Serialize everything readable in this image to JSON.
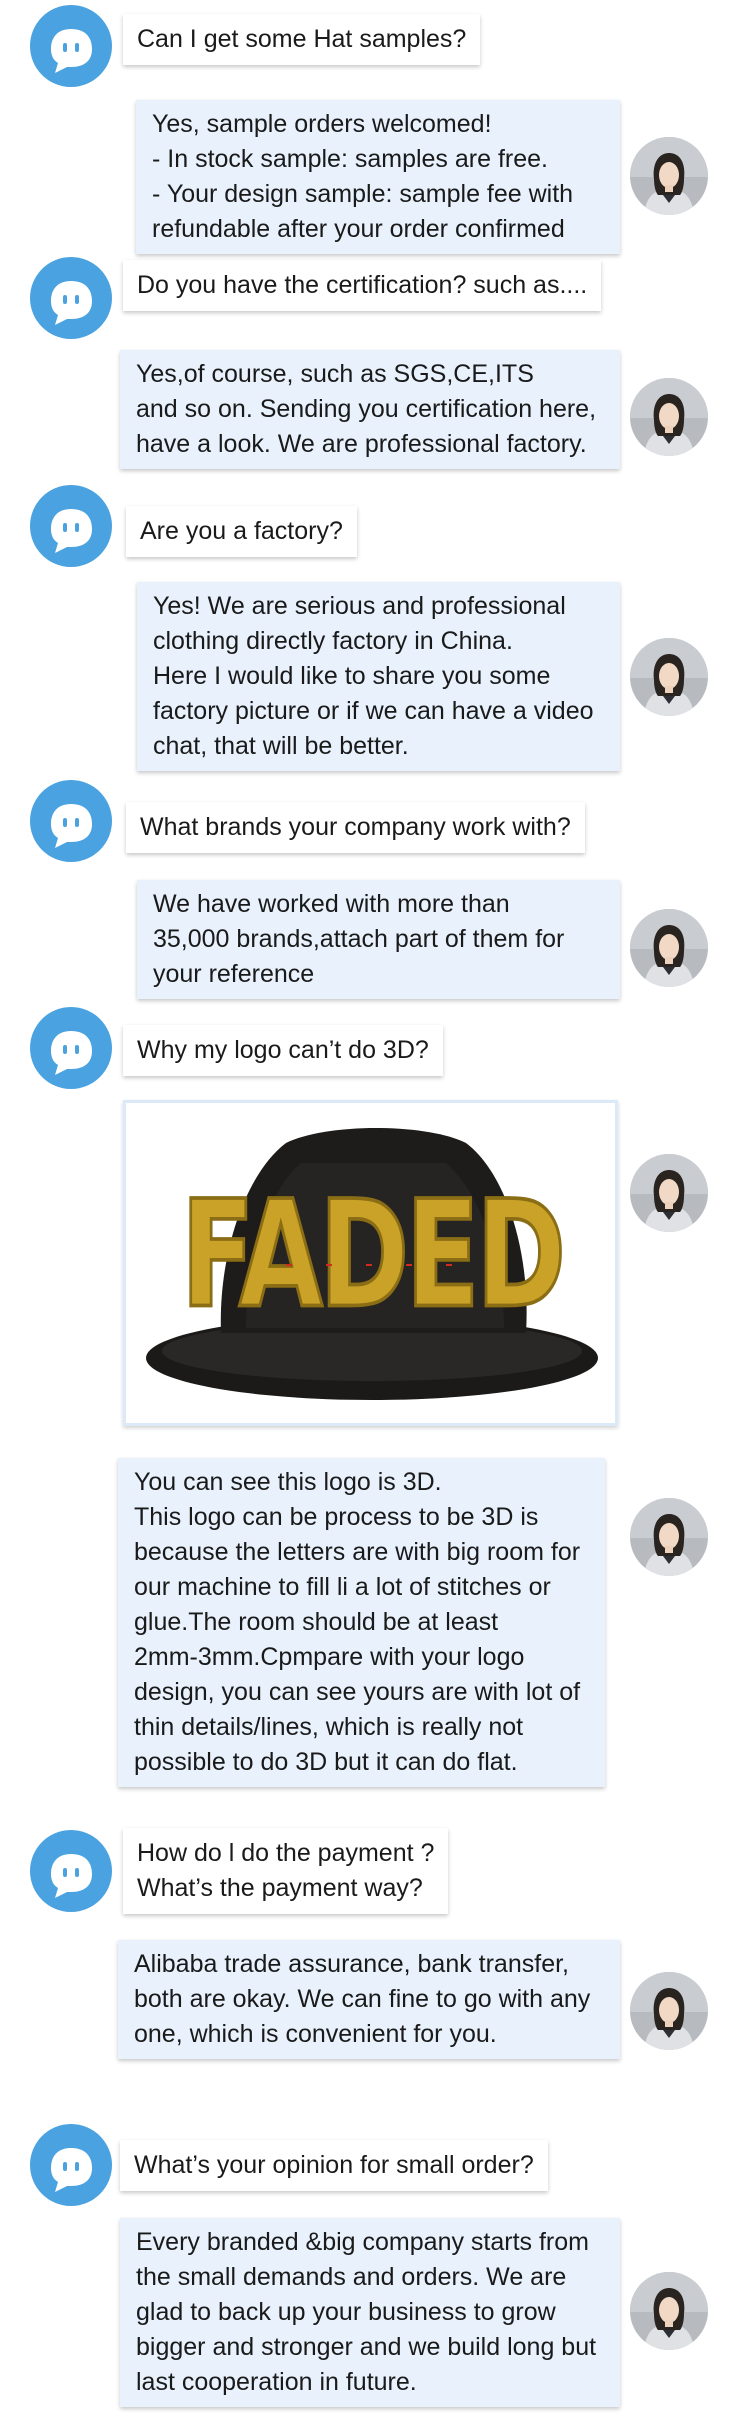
{
  "colors": {
    "bot_avatar": "#4aa3e0",
    "answer_bubble": "#e8f1fc",
    "question_bubble": "#ffffff",
    "hat_crown": "#1e1c1b",
    "hat_lettering": "#c9a227"
  },
  "conversation": [
    {
      "q": [
        "Can I get some Hat samples?"
      ],
      "a": [
        "Yes, sample orders welcomed!",
        "- In stock sample: samples are free.",
        "- Your design sample: sample fee with",
        "refundable after your order confirmed"
      ]
    },
    {
      "q": [
        "Do you have the certification? such as...."
      ],
      "a": [
        "Yes,of course, such as SGS,CE,ITS",
        "and so on. Sending you certification here,",
        "have a look. We are professional factory."
      ]
    },
    {
      "q": [
        "Are you a factory?"
      ],
      "a": [
        "Yes! We are serious and professional",
        "clothing directly factory in China.",
        "Here I would like to share you some",
        "factory picture or if we can have a video",
        "chat, that will be better."
      ]
    },
    {
      "q": [
        "What brands your company work with?"
      ],
      "a": [
        "We have worked with more than",
        "35,000 brands,attach part of them for",
        "your reference"
      ]
    },
    {
      "q": [
        "Why my logo can’t do 3D?"
      ],
      "image_text": "FADED",
      "a": [
        "You can see this logo is 3D.",
        "This logo can be process to be 3D is",
        "because the letters are with big room for",
        "our machine to fill li a lot of stitches or",
        "glue.The room should be at least",
        "2mm-3mm.Cpmpare with your logo",
        "design, you can see yours are with lot of",
        "thin details/lines, which is really not",
        "possible to do 3D but it can do flat."
      ]
    },
    {
      "q": [
        "How do l do the payment ?",
        "What’s the payment way?"
      ],
      "a": [
        "Alibaba trade assurance, bank transfer,",
        "both are okay. We can fine to go with any",
        "one, which is convenient for you."
      ]
    },
    {
      "q": [
        "What’s your opinion for small order?"
      ],
      "a": [
        "Every branded &big company starts from",
        "the small demands and orders. We are",
        "glad to back up your business to grow",
        "bigger and stronger and we build long but",
        "last cooperation in future."
      ]
    }
  ]
}
